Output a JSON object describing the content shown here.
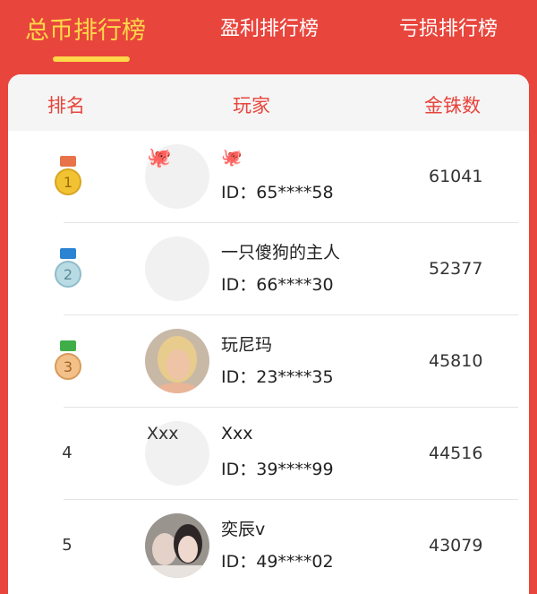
{
  "tabs": [
    {
      "label": "总币排行榜",
      "active": true
    },
    {
      "label": "盈利排行榜",
      "active": false
    },
    {
      "label": "亏损排行榜",
      "active": false
    }
  ],
  "table": {
    "headers": {
      "rank": "排名",
      "player": "玩家",
      "coins": "金铢数"
    }
  },
  "rows": [
    {
      "rank": "1",
      "medal": "gold-medal-icon",
      "avatar_text": "🐙",
      "name": "🐙",
      "id": "ID：65****58",
      "coins": "61041"
    },
    {
      "rank": "2",
      "medal": "silver-medal-icon",
      "avatar_text": "",
      "name": "一只傻狗的主人",
      "id": "ID：66****30",
      "coins": "52377"
    },
    {
      "rank": "3",
      "medal": "bronze-medal-icon",
      "avatar_text": "",
      "name": "玩尼玛",
      "id": "ID：23****35",
      "coins": "45810"
    },
    {
      "rank": "4",
      "medal": "",
      "avatar_text": "Xxx",
      "name": "Xxx",
      "id": "ID：39****99",
      "coins": "44516"
    },
    {
      "rank": "5",
      "medal": "",
      "avatar_text": "",
      "name": "奕辰v",
      "id": "ID：49****02",
      "coins": "43079"
    }
  ],
  "colors": {
    "accent": "#e8453c",
    "active_tab": "#ffd84a",
    "gold": "#f1c232",
    "silver": "#b9dbe3",
    "bronze": "#f3c08a"
  }
}
